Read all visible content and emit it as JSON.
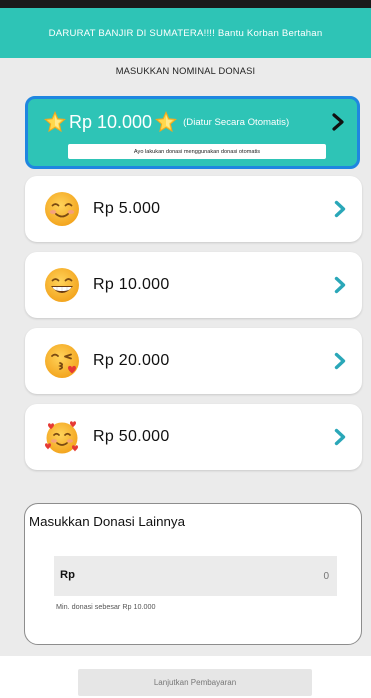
{
  "header": {
    "banner_text": "DARURAT BANJIR DI SUMATERA!!!!  Bantu Korban Bertahan"
  },
  "section": {
    "title": "MASUKKAN NOMINAL DONASI"
  },
  "featured": {
    "amount": "Rp 10.000",
    "note": "(Diatur Secara Otomatis)",
    "info": "Ayo lakukan donasi menggunakan donasi otomatis",
    "icon": "star-icon"
  },
  "options": [
    {
      "amount": "Rp 5.000",
      "icon": "smiling-emoji-icon"
    },
    {
      "amount": "Rp 10.000",
      "icon": "grinning-emoji-icon"
    },
    {
      "amount": "Rp 20.000",
      "icon": "kissing-heart-emoji-icon"
    },
    {
      "amount": "Rp 50.000",
      "icon": "smiling-hearts-emoji-icon"
    }
  ],
  "other": {
    "title": "Masukkan Donasi Lainnya",
    "currency": "Rp",
    "value": "",
    "placeholder": "0",
    "hint": "Min. donasi sebesar Rp 10.000"
  },
  "actions": {
    "continue_label": "Lanjutkan Pembayaran"
  },
  "colors": {
    "accent": "#2ec4b6",
    "highlight_border": "#1f86e0",
    "chevron": "#2aa7b8",
    "background": "#ebebeb"
  }
}
